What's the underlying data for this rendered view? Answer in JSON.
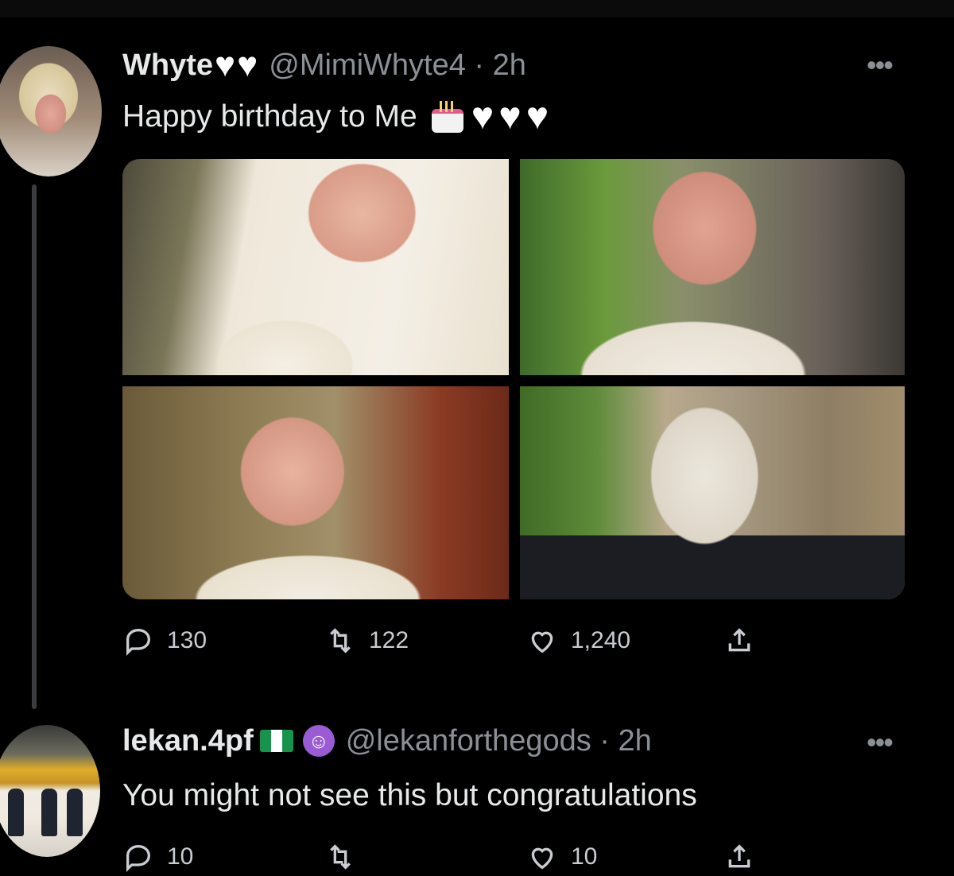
{
  "tweet1": {
    "name": "Whyte",
    "handle": "@MimiWhyte4 · 2h",
    "text": "Happy birthday to Me",
    "counts": {
      "replies": "130",
      "retweets": "122",
      "likes": "1,240"
    }
  },
  "tweet2": {
    "name": "lekan.4pf",
    "handle": "@lekanforthegods · 2h",
    "text": "You might not see this but congratulations",
    "counts": {
      "replies": "10",
      "retweets": "",
      "likes": "10"
    }
  },
  "icons": {
    "reply": "reply-icon",
    "retweet": "retweet-icon",
    "like": "like-icon",
    "share": "share-icon",
    "more": "more-icon",
    "white_heart": "white-heart-emoji",
    "cake": "birthday-cake-emoji",
    "flag": "nigeria-flag-emoji",
    "devil": "smiling-devil-emoji"
  },
  "colors": {
    "background": "#000000",
    "text": "#e7e9ea",
    "secondary": "#8b9096"
  }
}
